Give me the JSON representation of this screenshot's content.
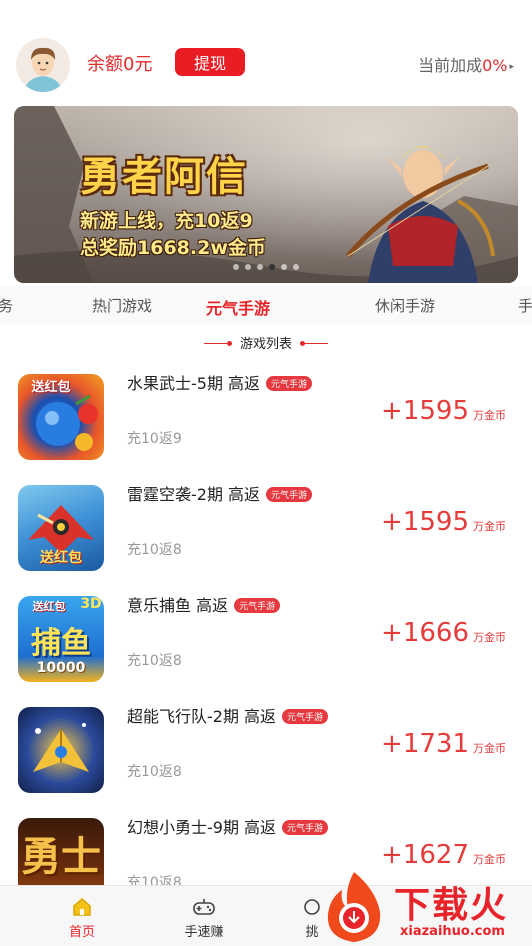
{
  "header": {
    "balance": "余额0元",
    "withdraw_label": "提现",
    "bonus_label": "当前加成",
    "bonus_value": "0%",
    "bonus_arrow": "▸"
  },
  "banner": {
    "title": "勇者阿信",
    "line1": "新游上线，充10返9",
    "line2": "总奖励1668.2w金币",
    "page_count": 6,
    "active_page": 4
  },
  "tabs": [
    "务",
    "热门游戏",
    "元气手游",
    "休闲手游",
    "手"
  ],
  "active_tab": "元气手游",
  "section_title": "游戏列表",
  "games": [
    {
      "name": "水果武士-5期 高返",
      "tag": "元气手游",
      "rebate": "充10返9",
      "reward": "+1595",
      "unit": "万金币",
      "icon_text": "送红包"
    },
    {
      "name": "雷霆空袭-2期  高返",
      "tag": "元气手游",
      "rebate": "充10返8",
      "reward": "+1595",
      "unit": "万金币",
      "icon_text": "送红包"
    },
    {
      "name": "意乐捕鱼 高返",
      "tag": "元气手游",
      "rebate": "充10返8",
      "reward": "+1666",
      "unit": "万金币",
      "icon_text": "送红包",
      "icon_text2": "捕鱼",
      "icon_text3": "3D",
      "icon_text4": "10000"
    },
    {
      "name": "超能飞行队-2期 高返",
      "tag": "元气手游",
      "rebate": "充10返8",
      "reward": "+1731",
      "unit": "万金币"
    },
    {
      "name": "幻想小勇士-9期 高返",
      "tag": "元气手游",
      "rebate": "充10返8",
      "reward": "+1627",
      "unit": "万金币",
      "icon_text": "勇士"
    }
  ],
  "bottom_nav": [
    {
      "label": "首页",
      "icon": "home-icon",
      "active": true
    },
    {
      "label": "手速赚",
      "icon": "gamepad-icon",
      "active": false
    },
    {
      "label": "挑",
      "icon": "challenge-icon",
      "active": false
    }
  ],
  "watermark": {
    "text": "下载火",
    "url": "xiazaihuo.com"
  },
  "colors": {
    "accent": "#e8242a",
    "reward": "#e53b3b",
    "muted": "#999999"
  }
}
